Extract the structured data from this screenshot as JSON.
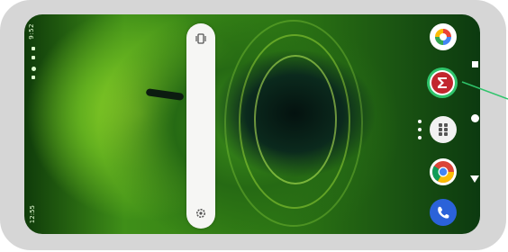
{
  "status_bar": {
    "time": "9:52",
    "bottom_text": "12:55"
  },
  "volume_panel": {
    "top_icon": "vibrate-icon",
    "bottom_icon": "settings-icon"
  },
  "dock": {
    "items": [
      {
        "name": "google-photos-icon"
      },
      {
        "name": "sigma-calculator-icon",
        "highlighted": true,
        "highlight_color": "#2fc46b"
      },
      {
        "name": "app-grid-icon"
      },
      {
        "name": "chrome-icon"
      },
      {
        "name": "phone-icon"
      }
    ]
  },
  "navigation": {
    "recents": "square-recents-icon",
    "home": "circle-home-icon",
    "back": "triangle-back-icon"
  },
  "colors": {
    "frame": "#d6d6d6",
    "highlight": "#2fc46b",
    "sigma_bg": "#c2262e"
  }
}
